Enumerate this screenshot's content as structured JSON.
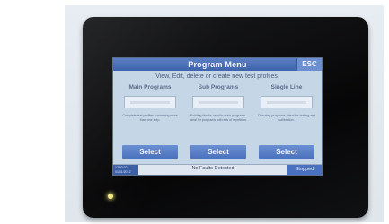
{
  "screen": {
    "title": "Program Menu",
    "esc_label": "ESC",
    "subtitle": "View, Edit, delete or create new test profiles.",
    "columns": [
      {
        "heading": "Main Programs",
        "description": "Complete test profiles containing more than one step.",
        "button": "Select"
      },
      {
        "heading": "Sub Programs",
        "description": "Building blocks used in main programs. Ideal for programs with lots of repetition.",
        "button": "Select"
      },
      {
        "heading": "Single Line",
        "description": "One step programs. Ideal for testing and calibration.",
        "button": "Select"
      }
    ],
    "status": {
      "left": "12:00:00 01/01/2012",
      "center": "No Faults Detected",
      "right": "Stopped"
    }
  },
  "colors": {
    "bezel": "#0b0c0d",
    "screen_background": "#c5d6e7",
    "accent_blue": "#4c71bd",
    "led": "#f3ee8a"
  }
}
